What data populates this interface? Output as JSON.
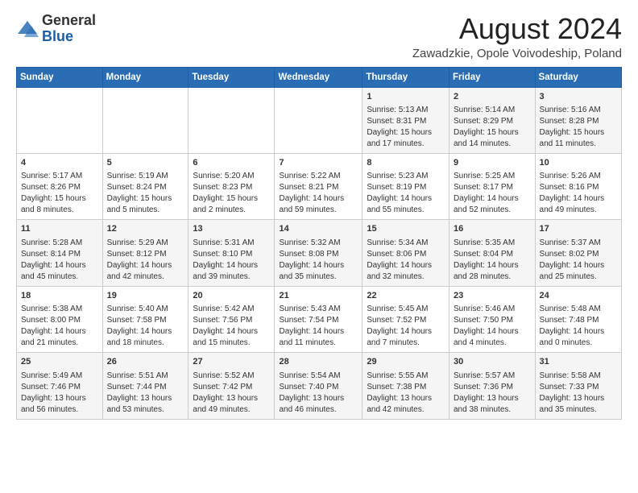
{
  "header": {
    "logo_general": "General",
    "logo_blue": "Blue",
    "month_year": "August 2024",
    "location": "Zawadzkie, Opole Voivodeship, Poland"
  },
  "weekdays": [
    "Sunday",
    "Monday",
    "Tuesday",
    "Wednesday",
    "Thursday",
    "Friday",
    "Saturday"
  ],
  "weeks": [
    [
      {
        "day": "",
        "text": ""
      },
      {
        "day": "",
        "text": ""
      },
      {
        "day": "",
        "text": ""
      },
      {
        "day": "",
        "text": ""
      },
      {
        "day": "1",
        "text": "Sunrise: 5:13 AM\nSunset: 8:31 PM\nDaylight: 15 hours\nand 17 minutes."
      },
      {
        "day": "2",
        "text": "Sunrise: 5:14 AM\nSunset: 8:29 PM\nDaylight: 15 hours\nand 14 minutes."
      },
      {
        "day": "3",
        "text": "Sunrise: 5:16 AM\nSunset: 8:28 PM\nDaylight: 15 hours\nand 11 minutes."
      }
    ],
    [
      {
        "day": "4",
        "text": "Sunrise: 5:17 AM\nSunset: 8:26 PM\nDaylight: 15 hours\nand 8 minutes."
      },
      {
        "day": "5",
        "text": "Sunrise: 5:19 AM\nSunset: 8:24 PM\nDaylight: 15 hours\nand 5 minutes."
      },
      {
        "day": "6",
        "text": "Sunrise: 5:20 AM\nSunset: 8:23 PM\nDaylight: 15 hours\nand 2 minutes."
      },
      {
        "day": "7",
        "text": "Sunrise: 5:22 AM\nSunset: 8:21 PM\nDaylight: 14 hours\nand 59 minutes."
      },
      {
        "day": "8",
        "text": "Sunrise: 5:23 AM\nSunset: 8:19 PM\nDaylight: 14 hours\nand 55 minutes."
      },
      {
        "day": "9",
        "text": "Sunrise: 5:25 AM\nSunset: 8:17 PM\nDaylight: 14 hours\nand 52 minutes."
      },
      {
        "day": "10",
        "text": "Sunrise: 5:26 AM\nSunset: 8:16 PM\nDaylight: 14 hours\nand 49 minutes."
      }
    ],
    [
      {
        "day": "11",
        "text": "Sunrise: 5:28 AM\nSunset: 8:14 PM\nDaylight: 14 hours\nand 45 minutes."
      },
      {
        "day": "12",
        "text": "Sunrise: 5:29 AM\nSunset: 8:12 PM\nDaylight: 14 hours\nand 42 minutes."
      },
      {
        "day": "13",
        "text": "Sunrise: 5:31 AM\nSunset: 8:10 PM\nDaylight: 14 hours\nand 39 minutes."
      },
      {
        "day": "14",
        "text": "Sunrise: 5:32 AM\nSunset: 8:08 PM\nDaylight: 14 hours\nand 35 minutes."
      },
      {
        "day": "15",
        "text": "Sunrise: 5:34 AM\nSunset: 8:06 PM\nDaylight: 14 hours\nand 32 minutes."
      },
      {
        "day": "16",
        "text": "Sunrise: 5:35 AM\nSunset: 8:04 PM\nDaylight: 14 hours\nand 28 minutes."
      },
      {
        "day": "17",
        "text": "Sunrise: 5:37 AM\nSunset: 8:02 PM\nDaylight: 14 hours\nand 25 minutes."
      }
    ],
    [
      {
        "day": "18",
        "text": "Sunrise: 5:38 AM\nSunset: 8:00 PM\nDaylight: 14 hours\nand 21 minutes."
      },
      {
        "day": "19",
        "text": "Sunrise: 5:40 AM\nSunset: 7:58 PM\nDaylight: 14 hours\nand 18 minutes."
      },
      {
        "day": "20",
        "text": "Sunrise: 5:42 AM\nSunset: 7:56 PM\nDaylight: 14 hours\nand 15 minutes."
      },
      {
        "day": "21",
        "text": "Sunrise: 5:43 AM\nSunset: 7:54 PM\nDaylight: 14 hours\nand 11 minutes."
      },
      {
        "day": "22",
        "text": "Sunrise: 5:45 AM\nSunset: 7:52 PM\nDaylight: 14 hours\nand 7 minutes."
      },
      {
        "day": "23",
        "text": "Sunrise: 5:46 AM\nSunset: 7:50 PM\nDaylight: 14 hours\nand 4 minutes."
      },
      {
        "day": "24",
        "text": "Sunrise: 5:48 AM\nSunset: 7:48 PM\nDaylight: 14 hours\nand 0 minutes."
      }
    ],
    [
      {
        "day": "25",
        "text": "Sunrise: 5:49 AM\nSunset: 7:46 PM\nDaylight: 13 hours\nand 56 minutes."
      },
      {
        "day": "26",
        "text": "Sunrise: 5:51 AM\nSunset: 7:44 PM\nDaylight: 13 hours\nand 53 minutes."
      },
      {
        "day": "27",
        "text": "Sunrise: 5:52 AM\nSunset: 7:42 PM\nDaylight: 13 hours\nand 49 minutes."
      },
      {
        "day": "28",
        "text": "Sunrise: 5:54 AM\nSunset: 7:40 PM\nDaylight: 13 hours\nand 46 minutes."
      },
      {
        "day": "29",
        "text": "Sunrise: 5:55 AM\nSunset: 7:38 PM\nDaylight: 13 hours\nand 42 minutes."
      },
      {
        "day": "30",
        "text": "Sunrise: 5:57 AM\nSunset: 7:36 PM\nDaylight: 13 hours\nand 38 minutes."
      },
      {
        "day": "31",
        "text": "Sunrise: 5:58 AM\nSunset: 7:33 PM\nDaylight: 13 hours\nand 35 minutes."
      }
    ]
  ]
}
